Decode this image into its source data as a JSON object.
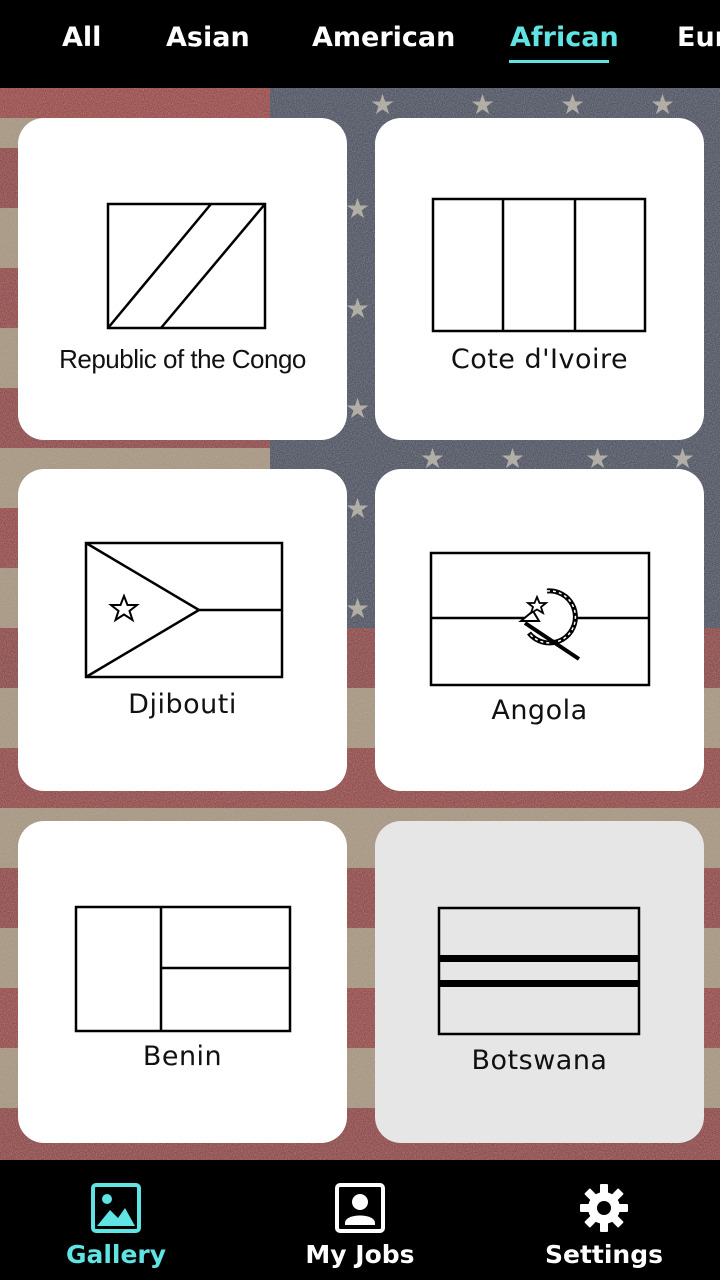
{
  "tabs": [
    {
      "label": "All",
      "active": false
    },
    {
      "label": "Asian",
      "active": false
    },
    {
      "label": "American",
      "active": false
    },
    {
      "label": "African",
      "active": true
    },
    {
      "label": "Eur",
      "active": false
    }
  ],
  "cards": [
    {
      "name": "Republic of the Congo",
      "flag": "congo-flag-icon",
      "selected": false
    },
    {
      "name": "Cote d'Ivoire",
      "flag": "cote-divoire-flag-icon",
      "selected": false
    },
    {
      "name": "Djibouti",
      "flag": "djibouti-flag-icon",
      "selected": false
    },
    {
      "name": "Angola",
      "flag": "angola-flag-icon",
      "selected": false
    },
    {
      "name": "Benin",
      "flag": "benin-flag-icon",
      "selected": false
    },
    {
      "name": "Botswana",
      "flag": "botswana-flag-icon",
      "selected": true
    }
  ],
  "nav": {
    "gallery": {
      "label": "Gallery",
      "icon": "gallery-icon",
      "active": true
    },
    "jobs": {
      "label": "My Jobs",
      "icon": "profile-icon",
      "active": false
    },
    "settings": {
      "label": "Settings",
      "icon": "gear-icon",
      "active": false
    }
  },
  "colors": {
    "accent": "#5fe3e3",
    "bar_background": "#000000",
    "card_background": "#ffffff",
    "card_selected_background": "#e6e6e6"
  }
}
